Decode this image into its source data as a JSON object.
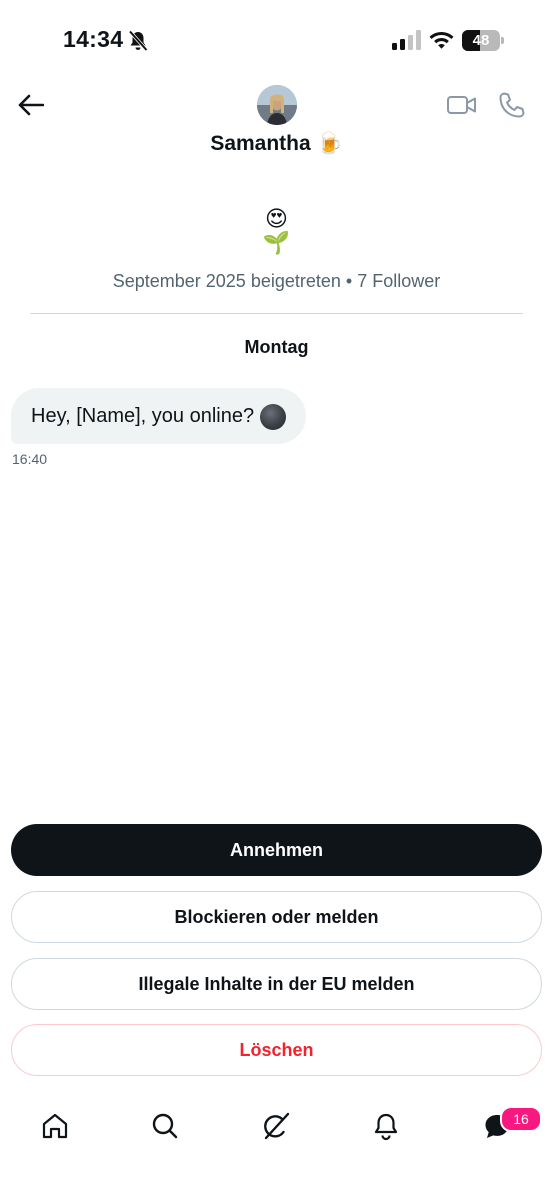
{
  "status_bar": {
    "time": "14:34",
    "battery_percent": 48,
    "battery_label": "48",
    "signal_bars": 2,
    "icons": [
      "bell-off-icon",
      "signal-icon",
      "wifi-icon",
      "battery-icon"
    ]
  },
  "header": {
    "back_icon": "arrow-left-icon",
    "contact_name": "Samantha",
    "name_emoji": "🍺",
    "actions": [
      "video-call-icon",
      "phone-call-icon"
    ]
  },
  "profile": {
    "bio_emoji_1": "😍",
    "bio_emoji_2": "🌱",
    "joined_text": "September 2025 beigetreten",
    "separator": "•",
    "followers_text": "7 Follower"
  },
  "conversation": {
    "day_label": "Montag",
    "messages": [
      {
        "text": "Hey, [Name], you online?",
        "emoji_icon": "new-moon-face-icon",
        "time": "16:40"
      }
    ]
  },
  "actions": {
    "accept_label": "Annehmen",
    "block_label": "Blockieren oder melden",
    "report_eu_label": "Illegale Inhalte in der EU melden",
    "delete_label": "Löschen"
  },
  "bottom_nav": {
    "items": [
      "home-icon",
      "search-icon",
      "grok-icon",
      "notifications-icon",
      "messages-icon"
    ],
    "messages_badge": "16"
  },
  "colors": {
    "primary_text": "#0f1419",
    "secondary_text": "#536471",
    "bubble_bg": "#eff3f4",
    "accept_bg": "#0f1419",
    "delete_text": "#f4212e",
    "badge_bg": "#f91880"
  }
}
